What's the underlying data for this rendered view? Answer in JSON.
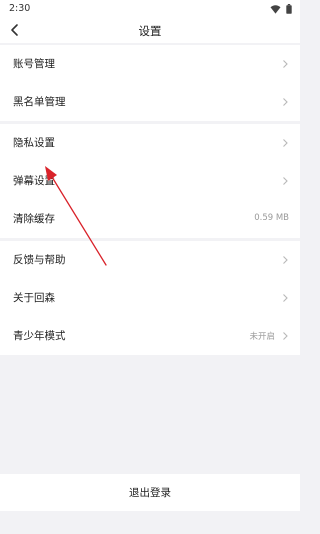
{
  "status_bar": {
    "time": "2:30"
  },
  "header": {
    "title": "设置"
  },
  "groups": [
    {
      "items": [
        {
          "label": "账号管理"
        },
        {
          "label": "黑名单管理"
        }
      ]
    },
    {
      "items": [
        {
          "label": "隐私设置"
        },
        {
          "label": "弹幕设置"
        },
        {
          "label": "清除缓存",
          "value": "0.59 MB"
        }
      ]
    },
    {
      "items": [
        {
          "label": "反馈与帮助"
        },
        {
          "label": "关于回森"
        },
        {
          "label": "青少年模式",
          "value": "未开启"
        }
      ]
    }
  ],
  "logout": {
    "label": "退出登录"
  },
  "colors": {
    "annotation_arrow": "#d9222a",
    "background": "#f2f2f5"
  }
}
